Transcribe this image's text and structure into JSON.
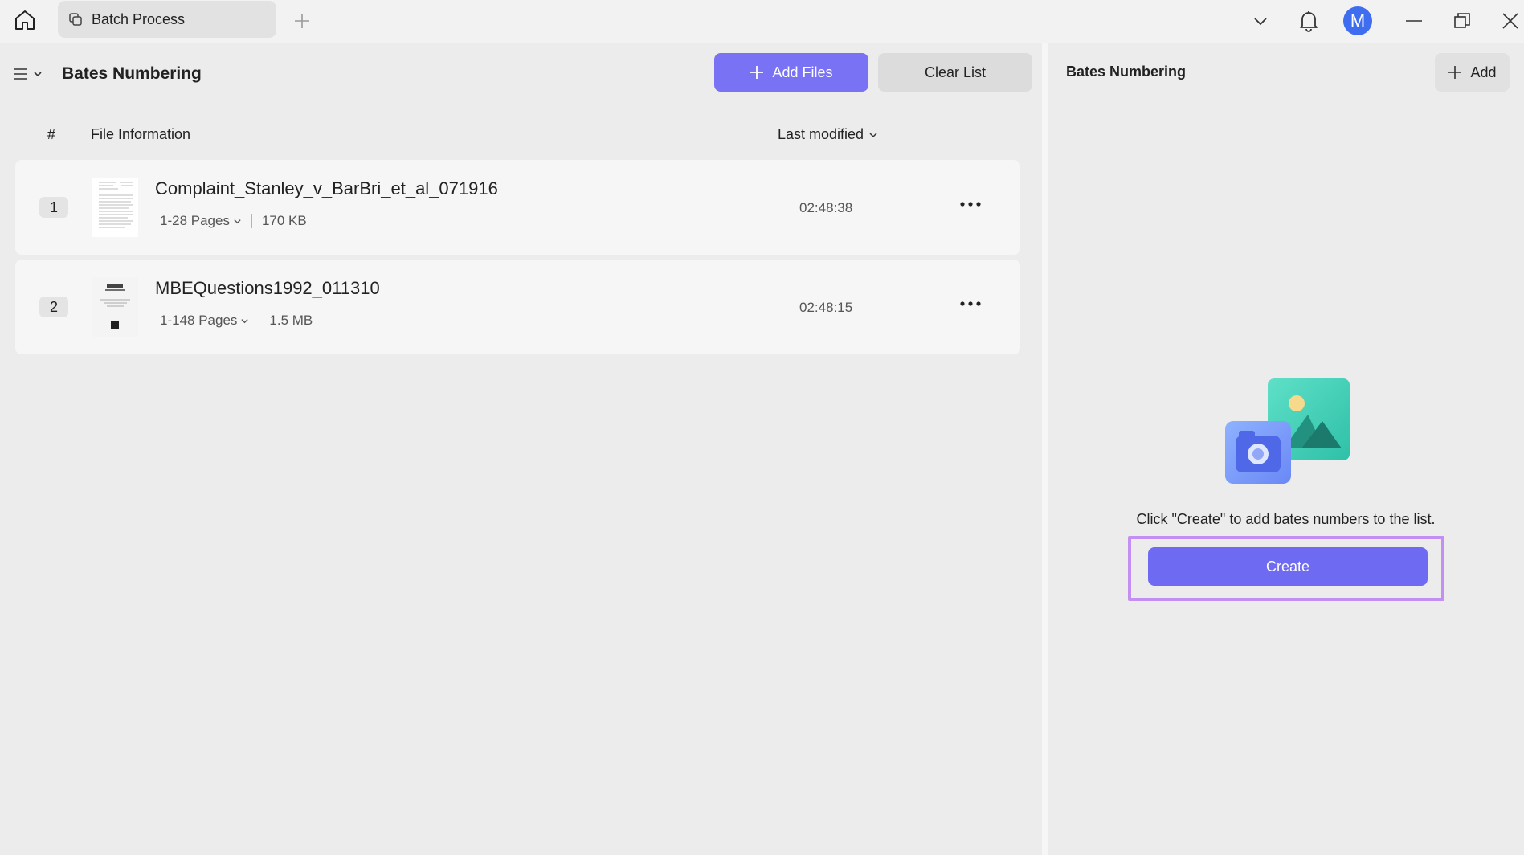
{
  "titlebar": {
    "tab_label": "Batch Process",
    "avatar_letter": "M"
  },
  "left": {
    "page_title": "Bates Numbering",
    "add_files_label": "Add Files",
    "clear_list_label": "Clear List",
    "columns": {
      "hash": "#",
      "info": "File Information",
      "modified": "Last modified"
    },
    "files": [
      {
        "index": "1",
        "name": "Complaint_Stanley_v_BarBri_et_al_071916",
        "pages": "1-28 Pages",
        "size": "170 KB",
        "time": "02:48:38"
      },
      {
        "index": "2",
        "name": "MBEQuestions1992_011310",
        "pages": "1-148 Pages",
        "size": "1.5 MB",
        "time": "02:48:15"
      }
    ]
  },
  "right": {
    "title": "Bates Numbering",
    "add_label": "Add",
    "empty_message": "Click \"Create\" to add bates numbers to the list.",
    "create_label": "Create"
  },
  "colors": {
    "primary": "#7a72f5",
    "create": "#6e6af2",
    "highlight": "#c38ff0",
    "avatar": "#3f6df0"
  }
}
